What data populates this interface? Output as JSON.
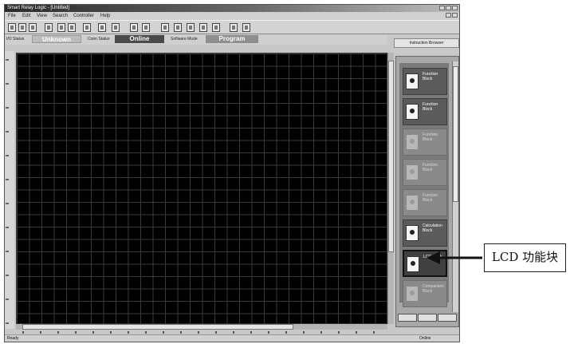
{
  "window": {
    "title": "Smart Relay Logic - [Untitled]"
  },
  "menu": {
    "items": [
      "File",
      "Edit",
      "View",
      "Search",
      "Controller",
      "Help"
    ]
  },
  "toolbar": {
    "icons": [
      "new-icon",
      "open-icon",
      "save-icon",
      "cut-icon",
      "undo-icon",
      "redo-icon",
      "read-icon",
      "write-icon",
      "monitor-icon",
      "run-icon",
      "stop-icon",
      "zoom-in-icon",
      "zoom-out-icon",
      "grid-icon",
      "print-icon",
      "compile-icon",
      "help-icon",
      "pointer-icon"
    ]
  },
  "status_strip": {
    "label1": "I/O Status",
    "value1": "Unknown",
    "label2": "Conn Status",
    "value2": "Online",
    "label3": "Software Mode",
    "value3": "Program"
  },
  "panel": {
    "header": "Instruction Browser",
    "blocks": [
      {
        "label": "Function Block",
        "state": "normal"
      },
      {
        "label": "Function Block",
        "state": "normal"
      },
      {
        "label": "Function Block",
        "state": "dim"
      },
      {
        "label": "Function Block",
        "state": "dim"
      },
      {
        "label": "Function Block",
        "state": "dim"
      },
      {
        "label": "Calculation Block",
        "state": "normal"
      },
      {
        "label": "LCD Block",
        "state": "selected"
      },
      {
        "label": "Comparison Block",
        "state": "dim"
      }
    ]
  },
  "statusbar": {
    "left": "Ready",
    "right": "Online"
  },
  "callout": {
    "text": "LCD 功能块"
  }
}
